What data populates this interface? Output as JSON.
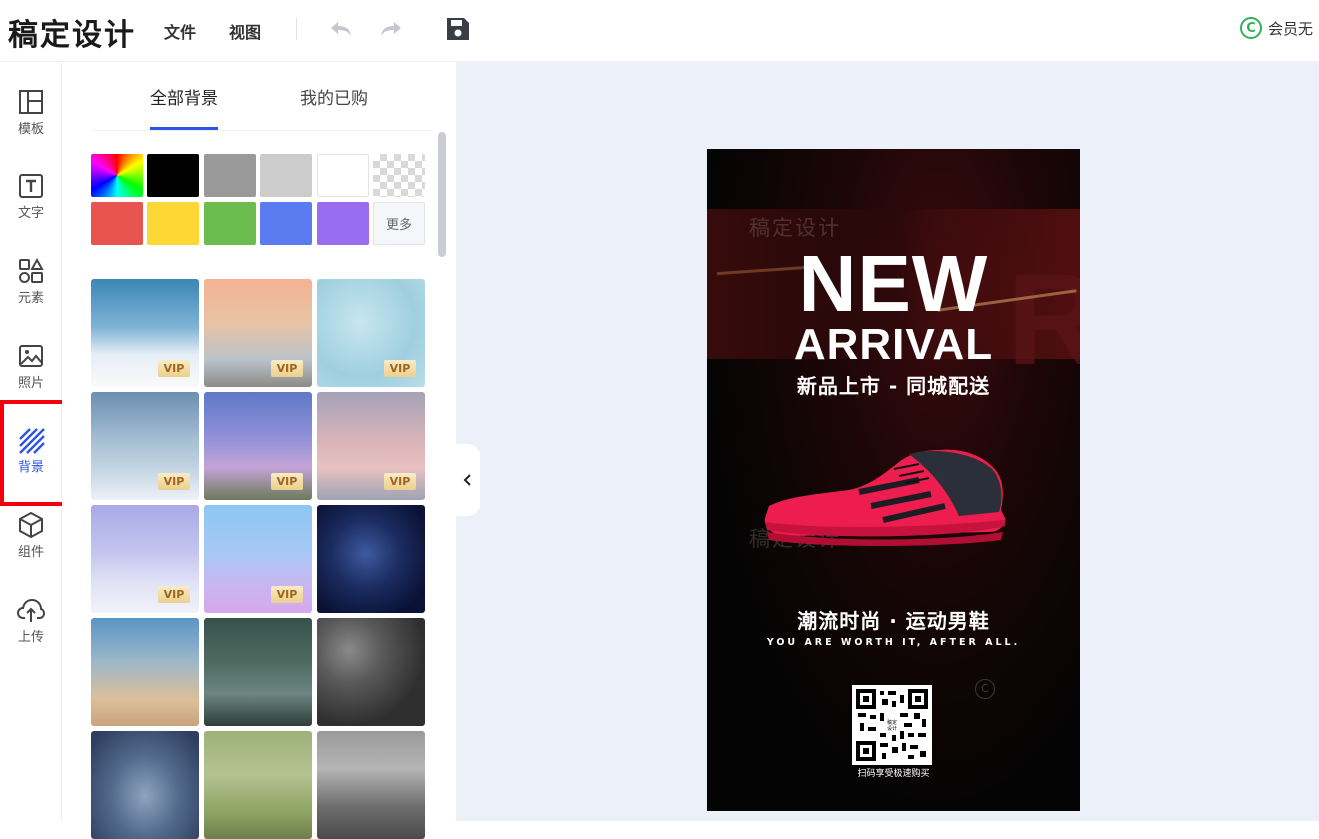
{
  "app": {
    "brand": "稿定设计",
    "menu": [
      "文件",
      "视图"
    ],
    "vip_status": "会员无"
  },
  "sidebar": {
    "items": [
      {
        "label": "模板",
        "icon": "layout-icon"
      },
      {
        "label": "文字",
        "icon": "text-icon"
      },
      {
        "label": "元素",
        "icon": "shapes-icon"
      },
      {
        "label": "照片",
        "icon": "image-icon"
      },
      {
        "label": "背景",
        "icon": "background-stripes-icon",
        "active": true
      },
      {
        "label": "组件",
        "icon": "cube-icon"
      },
      {
        "label": "上传",
        "icon": "cloud-upload-icon"
      }
    ]
  },
  "panel": {
    "tabs": [
      "全部背景",
      "我的已购"
    ],
    "active_tab": 0,
    "more_colors": "更多",
    "colors": [
      "#ff0000-rainbow",
      "#000000",
      "#999999",
      "#cccccc",
      "#ffffff",
      "transparent",
      "#e85450",
      "#fdd835",
      "#6cbd4f",
      "#5b7cf0",
      "#9a6df0"
    ],
    "vip_label": "VIP"
  },
  "poster": {
    "watermark": "稿定设计",
    "headline": "NEW",
    "headline2": "ARRIVAL",
    "subtitle": "新品上市 - 同城配送",
    "slogan": "潮流时尚 · 运动男鞋",
    "tagline": "YOU ARE WORTH IT, AFTER ALL.",
    "qr_label": "扫码享受极速购买"
  }
}
